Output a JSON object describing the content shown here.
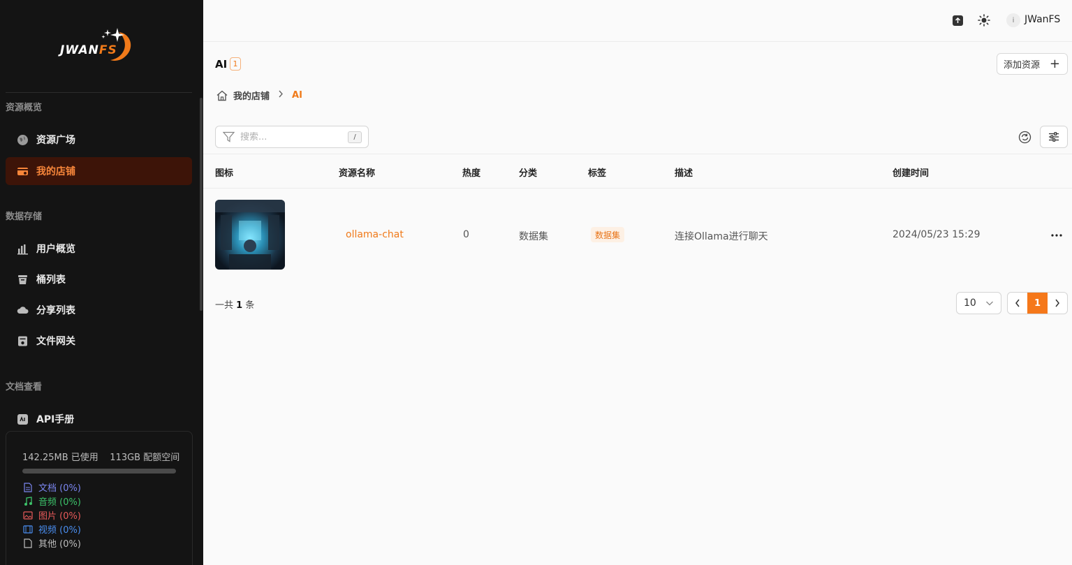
{
  "app": {
    "logo_main": "JWAN",
    "logo_accent": "FS"
  },
  "sidebar": {
    "sections": [
      {
        "title": "资源概览"
      },
      {
        "title": "数据存储"
      },
      {
        "title": "文档查看"
      }
    ],
    "items": [
      {
        "label": "资源广场",
        "icon": "globe-icon"
      },
      {
        "label": "我的店铺",
        "icon": "shop-icon",
        "active": true
      },
      {
        "label": "用户概览",
        "icon": "bar-chart-icon"
      },
      {
        "label": "桶列表",
        "icon": "bucket-icon"
      },
      {
        "label": "分享列表",
        "icon": "cloud-share-icon"
      },
      {
        "label": "文件网关",
        "icon": "gateway-icon"
      },
      {
        "label": "API手册",
        "icon": "api-icon"
      }
    ],
    "storage": {
      "used": "142.25MB 已使用",
      "quota": "113GB 配额空间",
      "usage_fraction": 0.0,
      "types": [
        {
          "label": "文档 (0%)",
          "color": "#7b86f0",
          "icon": "document-icon"
        },
        {
          "label": "音频 (0%)",
          "color": "#3cc26a",
          "icon": "music-icon"
        },
        {
          "label": "图片 (0%)",
          "color": "#e85a5a",
          "icon": "image-icon"
        },
        {
          "label": "视频 (0%)",
          "color": "#4a8ef0",
          "icon": "video-icon"
        },
        {
          "label": "其他 (0%)",
          "color": "#bdbdbd",
          "icon": "file-icon"
        }
      ]
    }
  },
  "topbar": {
    "avatar_initial": "i",
    "username": "JWanFS"
  },
  "page": {
    "title": "AI",
    "count": "1",
    "add_button": "添加资源",
    "breadcrumb": {
      "home": "我的店铺",
      "current": "AI"
    },
    "search": {
      "placeholder": "搜索...",
      "shortcut": "/"
    }
  },
  "table": {
    "columns": [
      "图标",
      "资源名称",
      "热度",
      "分类",
      "标签",
      "描述",
      "创建时间"
    ],
    "rows": [
      {
        "name": "ollama-chat",
        "heat": "0",
        "category": "数据集",
        "tag": "数据集",
        "description": "连接Ollama进行聊天",
        "created": "2024/05/23 15:29"
      }
    ]
  },
  "footer": {
    "total_prefix": "一共",
    "total_count": "1",
    "total_suffix": "条",
    "page_size": "10",
    "current_page": "1"
  },
  "colors": {
    "accent": "#f5781a",
    "sidebar_bg": "#141414",
    "active_bg": "#3d1408"
  }
}
